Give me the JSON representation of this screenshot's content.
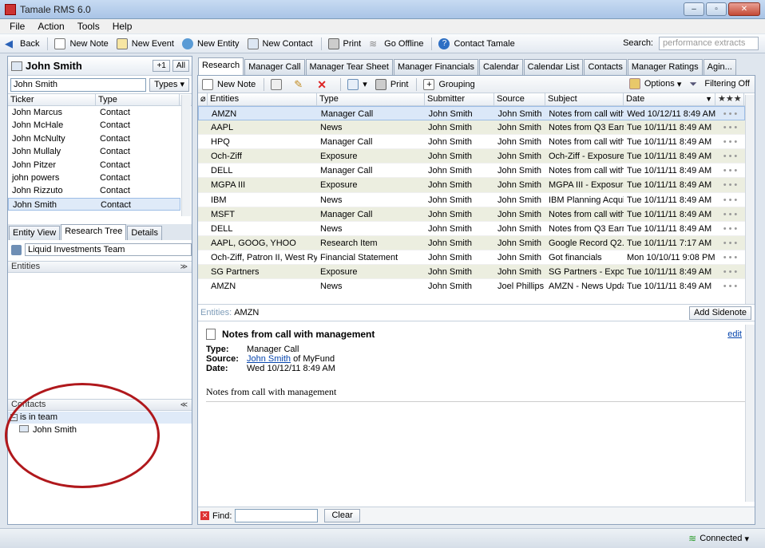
{
  "window": {
    "title": "Tamale RMS 6.0"
  },
  "menu": [
    "File",
    "Action",
    "Tools",
    "Help"
  ],
  "toolbar": {
    "back": "Back",
    "new_note": "New Note",
    "new_event": "New Event",
    "new_entity": "New Entity",
    "new_contact": "New Contact",
    "print": "Print",
    "go_offline": "Go Offline",
    "contact_tamale": "Contact Tamale",
    "search_label": "Search:",
    "search_placeholder": "performance extracts"
  },
  "left": {
    "entity_name": "John Smith",
    "plus_btn": "+1",
    "all_btn": "All",
    "search_value": "John Smith",
    "types_btn": "Types",
    "col_ticker": "Ticker",
    "col_type": "Type",
    "rows": [
      {
        "ticker": "John Marcus",
        "type": "Contact"
      },
      {
        "ticker": "John McHale",
        "type": "Contact"
      },
      {
        "ticker": "John McNulty",
        "type": "Contact"
      },
      {
        "ticker": "John Mullaly",
        "type": "Contact"
      },
      {
        "ticker": "John Pitzer",
        "type": "Contact"
      },
      {
        "ticker": "john powers",
        "type": "Contact"
      },
      {
        "ticker": "John Rizzuto",
        "type": "Contact"
      },
      {
        "ticker": "John Smith",
        "type": "Contact"
      }
    ],
    "tabs": [
      "Entity View",
      "Research Tree",
      "Details"
    ],
    "team": "Liquid Investments Team",
    "entities_header": "Entities",
    "contacts_header": "Contacts",
    "is_in_team": "is in team",
    "contact_name": "John Smith"
  },
  "right": {
    "tabs": [
      "Research",
      "Manager Call",
      "Manager Tear Sheet",
      "Manager Financials",
      "Calendar",
      "Calendar List",
      "Contacts",
      "Manager Ratings",
      "Agin..."
    ],
    "tool": {
      "new_note": "New Note",
      "print": "Print",
      "grouping": "Grouping",
      "options": "Options",
      "filtering": "Filtering Off"
    },
    "cols": {
      "entities": "Entities",
      "type": "Type",
      "submitter": "Submitter",
      "source": "Source",
      "subject": "Subject",
      "date": "Date"
    },
    "rows": [
      {
        "entities": "AMZN",
        "type": "Manager Call",
        "submitter": "John Smith",
        "source": "John Smith",
        "subject": "Notes from call with...",
        "date": "Wed 10/12/11 8:49 AM"
      },
      {
        "entities": "AAPL",
        "type": "News",
        "submitter": "John Smith",
        "source": "John Smith",
        "subject": "Notes from Q3 Earni...",
        "date": "Tue 10/11/11 8:49 AM"
      },
      {
        "entities": "HPQ",
        "type": "Manager Call",
        "submitter": "John Smith",
        "source": "John Smith",
        "subject": "Notes from call with...",
        "date": "Tue 10/11/11 8:49 AM"
      },
      {
        "entities": "Och-Ziff",
        "type": "Exposure",
        "submitter": "John Smith",
        "source": "John Smith",
        "subject": "Och-Ziff - Exposure",
        "date": "Tue 10/11/11 8:49 AM"
      },
      {
        "entities": "DELL",
        "type": "Manager Call",
        "submitter": "John Smith",
        "source": "John Smith",
        "subject": "Notes from call with...",
        "date": "Tue 10/11/11 8:49 AM"
      },
      {
        "entities": "MGPA III",
        "type": "Exposure",
        "submitter": "John Smith",
        "source": "John Smith",
        "subject": "MGPA III - Exposure",
        "date": "Tue 10/11/11 8:49 AM"
      },
      {
        "entities": "IBM",
        "type": "News",
        "submitter": "John Smith",
        "source": "John Smith",
        "subject": "IBM Planning Acquis...",
        "date": "Tue 10/11/11 8:49 AM"
      },
      {
        "entities": "MSFT",
        "type": "Manager Call",
        "submitter": "John Smith",
        "source": "John Smith",
        "subject": "Notes from call with...",
        "date": "Tue 10/11/11 8:49 AM"
      },
      {
        "entities": "DELL",
        "type": "News",
        "submitter": "John Smith",
        "source": "John Smith",
        "subject": "Notes from Q3 Earni...",
        "date": "Tue 10/11/11 8:49 AM"
      },
      {
        "entities": "AAPL, GOOG, YHOO",
        "type": "Research Item",
        "submitter": "John Smith",
        "source": "John Smith",
        "subject": "Google Record Q2...",
        "date": "Tue 10/11/11 7:17 AM"
      },
      {
        "entities": "Och-Ziff, Patron II, West Rye...",
        "type": "Financial Statement",
        "submitter": "John Smith",
        "source": "John Smith",
        "subject": "Got financials",
        "date": "Mon 10/10/11 9:08 PM"
      },
      {
        "entities": "SG Partners",
        "type": "Exposure",
        "submitter": "John Smith",
        "source": "John Smith",
        "subject": "SG Partners - Expos...",
        "date": "Tue 10/11/11 8:49 AM"
      },
      {
        "entities": "AMZN",
        "type": "News",
        "submitter": "John Smith",
        "source": "Joel Phillips",
        "subject": "AMZN - News Updat...",
        "date": "Tue 10/11/11 8:49 AM"
      }
    ],
    "entities_label": "Entities:",
    "entities_value": "AMZN",
    "add_sidenote": "Add Sidenote",
    "note": {
      "title": "Notes from call with management",
      "edit": "edit",
      "type_lbl": "Type:",
      "type_val": "Manager Call",
      "source_lbl": "Source:",
      "source_link": "John Smith",
      "source_rest": "of MyFund",
      "date_lbl": "Date:",
      "date_val": "Wed 10/12/11 8:49 AM",
      "body": "Notes from call with management"
    },
    "find_label": "Find:",
    "clear": "Clear"
  },
  "status": {
    "connected": "Connected"
  }
}
